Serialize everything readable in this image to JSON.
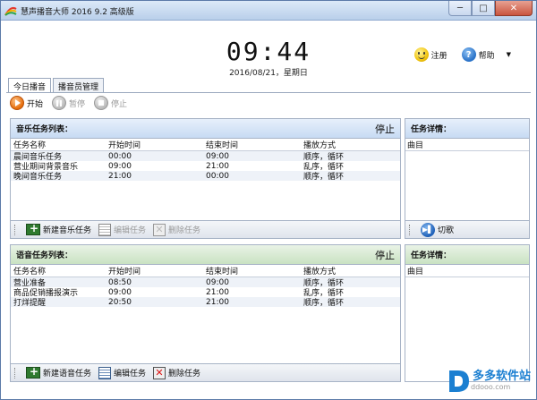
{
  "window": {
    "title": "慧声播音大师 2016 9.2 高级版",
    "min_label": "─",
    "max_label": "□",
    "close_label": "✕"
  },
  "clock": {
    "time": "09:44",
    "date": "2016/08/21，星期日"
  },
  "header": {
    "register_label": "注册",
    "help_label": "帮助",
    "dropdown_glyph": "▼"
  },
  "tabs": [
    {
      "label": "今日播音",
      "active": true
    },
    {
      "label": "播音员管理",
      "active": false
    }
  ],
  "toolbar": {
    "start": "开始",
    "pause": "暂停",
    "stop": "停止"
  },
  "music_panel": {
    "title": "音乐任务列表：",
    "status": "停止",
    "columns": [
      "任务名称",
      "开始时间",
      "结束时间",
      "播放方式"
    ],
    "rows": [
      [
        "晨间音乐任务",
        "00:00",
        "09:00",
        "顺序，循环"
      ],
      [
        "营业期间背景音乐",
        "09:00",
        "21:00",
        "乱序，循环"
      ],
      [
        "晚间音乐任务",
        "21:00",
        "00:00",
        "顺序，循环"
      ]
    ],
    "footer": {
      "new": "新建音乐任务",
      "edit": "编辑任务",
      "delete": "删除任务"
    }
  },
  "music_detail": {
    "title": "任务详情：",
    "column": "曲目",
    "footer_next": "切歌"
  },
  "voice_panel": {
    "title": "语音任务列表：",
    "status": "停止",
    "columns": [
      "任务名称",
      "开始时间",
      "结束时间",
      "播放方式"
    ],
    "rows": [
      [
        "营业准备",
        "08:50",
        "09:00",
        "顺序，循环"
      ],
      [
        "商品促销播报演示",
        "09:00",
        "21:00",
        "乱序，循环"
      ],
      [
        "打烊提醒",
        "20:50",
        "21:00",
        "顺序，循环"
      ]
    ],
    "footer": {
      "new": "新建语音任务",
      "edit": "编辑任务",
      "delete": "删除任务"
    }
  },
  "voice_detail": {
    "title": "任务详情：",
    "column": "曲目"
  },
  "watermark": {
    "text": "多多软件站",
    "sub": "ddooo.com"
  }
}
